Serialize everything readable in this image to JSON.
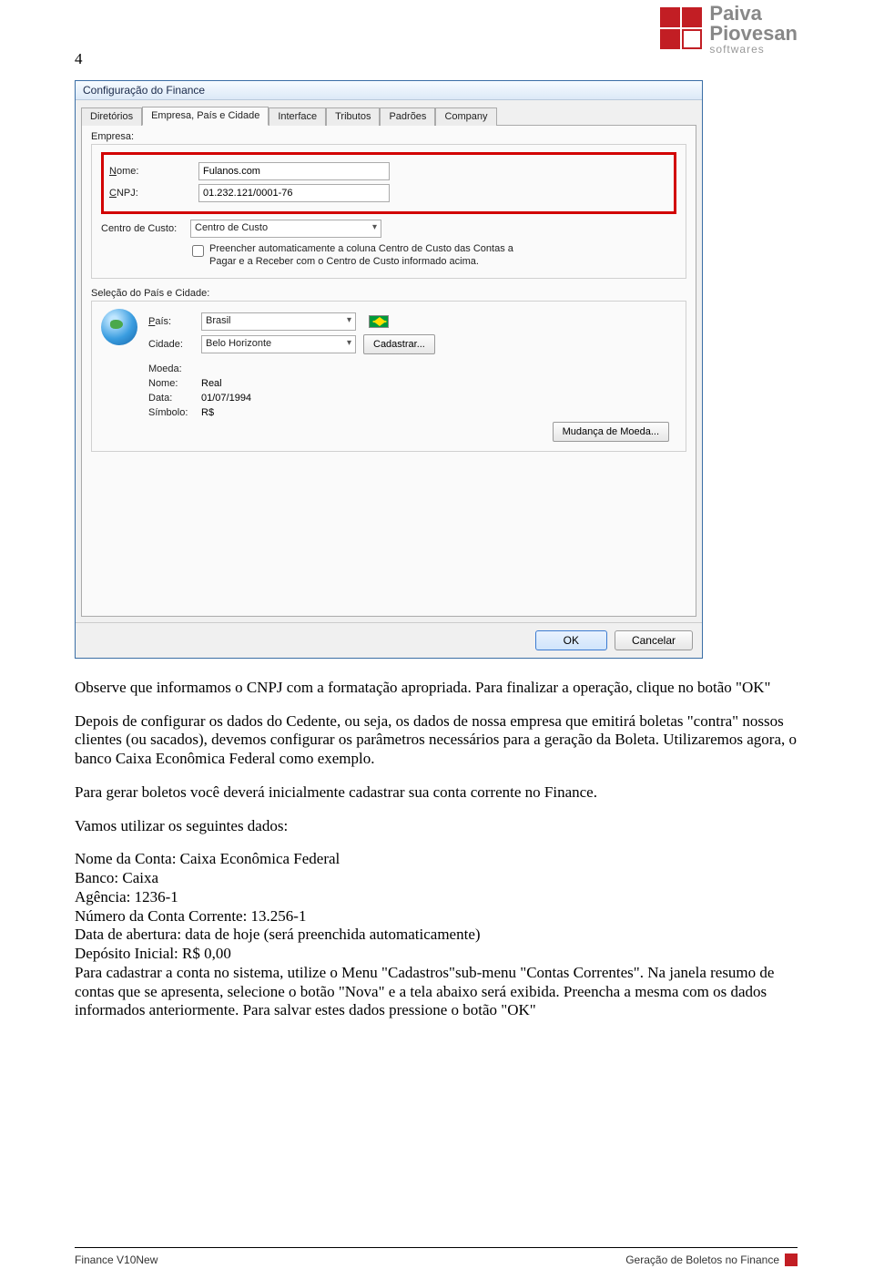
{
  "page_number": "4",
  "brand": {
    "line1": "Paiva",
    "line2": "Piovesan",
    "line3": "softwares"
  },
  "window": {
    "title": "Configuração do Finance",
    "tabs": [
      "Diretórios",
      "Empresa, País e Cidade",
      "Interface",
      "Tributos",
      "Padrões",
      "Company"
    ],
    "active_tab_index": 1,
    "empresa": {
      "group_label": "Empresa:",
      "nome_label": "Nome:",
      "nome_value": "Fulanos.com",
      "cnpj_label": "CNPJ:",
      "cnpj_value": "01.232.121/0001-76",
      "centro_label": "Centro de Custo:",
      "centro_value": "Centro de Custo",
      "check_label": "Preencher automaticamente a coluna Centro de Custo das Contas a Pagar e a Receber com o Centro de Custo informado acima."
    },
    "pais_cidade": {
      "group_label": "Seleção do País e Cidade:",
      "pais_label": "País:",
      "pais_value": "Brasil",
      "cidade_label": "Cidade:",
      "cidade_value": "Belo Horizonte",
      "cadastrar_btn": "Cadastrar...",
      "moeda_label": "Moeda:",
      "moeda_nome_label": "Nome:",
      "moeda_nome_value": "Real",
      "moeda_data_label": "Data:",
      "moeda_data_value": "01/07/1994",
      "moeda_simbolo_label": "Símbolo:",
      "moeda_simbolo_value": "R$",
      "mudanca_btn": "Mudança de Moeda..."
    },
    "ok_btn": "OK",
    "cancel_btn": "Cancelar"
  },
  "body": {
    "p1": "Observe que informamos o CNPJ com a formatação apropriada. Para finalizar a operação, clique no botão \"OK\"",
    "p2": "Depois de configurar os dados do Cedente, ou seja, os dados de nossa empresa que emitirá boletas \"contra\" nossos clientes (ou sacados), devemos configurar os parâmetros necessários para a geração da Boleta. Utilizaremos agora, o banco Caixa Econômica Federal como exemplo.",
    "p3": "Para gerar boletos você deverá inicialmente cadastrar sua conta corrente no Finance.",
    "p4": "Vamos utilizar os seguintes dados:",
    "p5a": "Nome da Conta: Caixa Econômica Federal",
    "p5b": "Banco: Caixa",
    "p5c": "Agência: 1236-1",
    "p5d": "Número da Conta Corrente: 13.256-1",
    "p5e": "Data de abertura: data de hoje (será preenchida automaticamente)",
    "p5f": "Depósito Inicial: R$ 0,00",
    "p5g": "Para cadastrar a conta no sistema, utilize o Menu \"Cadastros\"sub-menu \"Contas Correntes\". Na janela resumo de contas que se apresenta, selecione o botão \"Nova\" e a tela abaixo será exibida. Preencha a mesma com os dados informados anteriormente. Para salvar estes dados pressione o botão \"OK\""
  },
  "footer": {
    "left": "Finance V10New",
    "right": "Geração de Boletos no Finance"
  }
}
